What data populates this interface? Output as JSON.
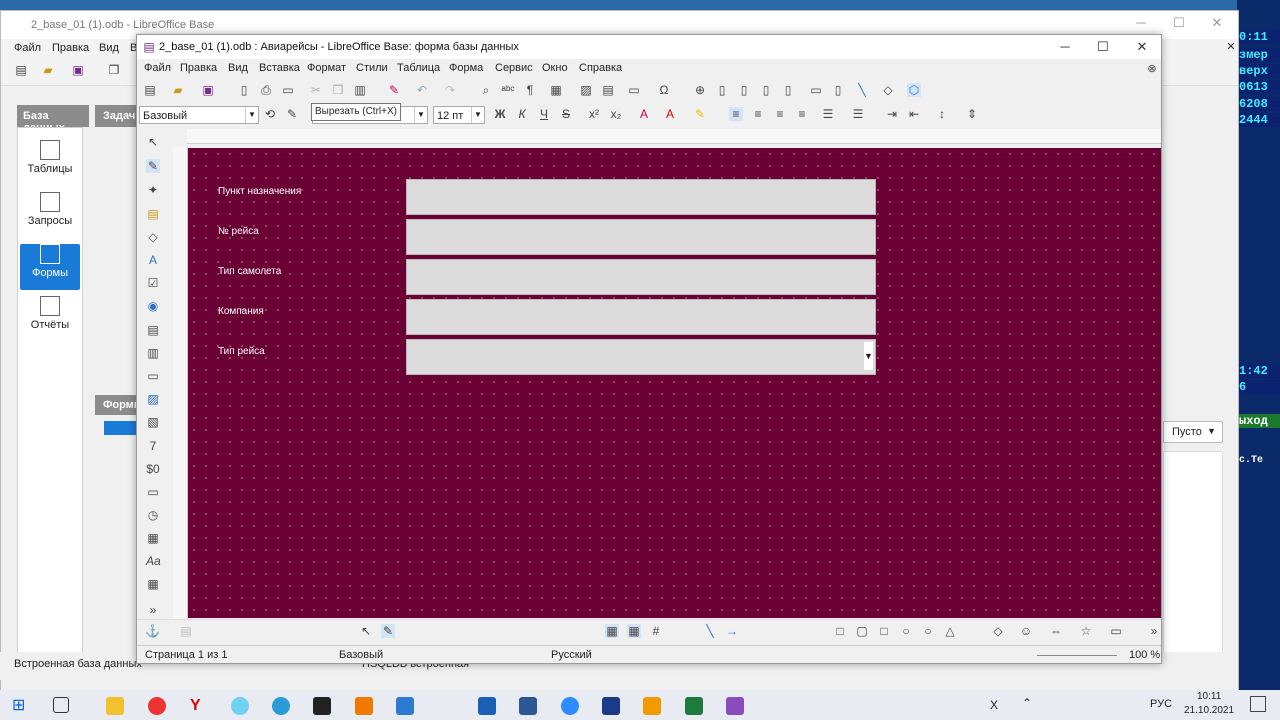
{
  "back_window": {
    "title": "2_base_01 (1).odb - LibreOffice Base",
    "menu": [
      "Файл",
      "Правка",
      "Вид",
      "Вс"
    ],
    "panel_db_title": "База данных",
    "panel_tasks_title": "Задачи",
    "db_items": [
      {
        "label": "Таблицы",
        "icon": "table-icon"
      },
      {
        "label": "Запросы",
        "icon": "query-icon"
      },
      {
        "label": "Формы",
        "icon": "form-icon"
      },
      {
        "label": "Отчёты",
        "icon": "report-icon"
      }
    ],
    "forms_section_title": "Формы",
    "preview_select": "Пусто",
    "status_left": "Встроенная база данных",
    "status_mid": "HSQLDB встроенная"
  },
  "main_window": {
    "title": "2_base_01 (1).odb : Авиарейсы - LibreOffice Base: форма базы данных",
    "menu": [
      "Файл",
      "Правка",
      "Вид",
      "Вставка",
      "Формат",
      "Стили",
      "Таблица",
      "Форма",
      "Сервис",
      "Окно",
      "Справка"
    ],
    "tooltip": "Вырезать (Ctrl+X)",
    "style_combo": "Базовый",
    "font_size_combo": "12 пт",
    "bold_label": "Ж",
    "italic_label": "К",
    "underline_label": "Ч",
    "strike_label": "S",
    "form": {
      "background": "#6a0033",
      "fields": [
        {
          "label": "Пункт назначения",
          "type": "text"
        },
        {
          "label": "№ рейса",
          "type": "text"
        },
        {
          "label": "Тип самолета",
          "type": "text"
        },
        {
          "label": "Компания",
          "type": "text"
        },
        {
          "label": "Тип рейса",
          "type": "listbox"
        }
      ]
    },
    "status": {
      "page": "Страница 1 из 1",
      "style": "Базовый",
      "language": "Русский",
      "zoom": "100 %"
    }
  },
  "right_strip": [
    "0:11",
    "змер",
    "верх",
    "0613",
    "6208",
    "2444",
    "1:42",
    "6",
    "ыход",
    "c.Te"
  ],
  "taskbar": {
    "lang": "РУС",
    "time": "10:11",
    "date": "21.10.2021",
    "tray_x": "X"
  }
}
